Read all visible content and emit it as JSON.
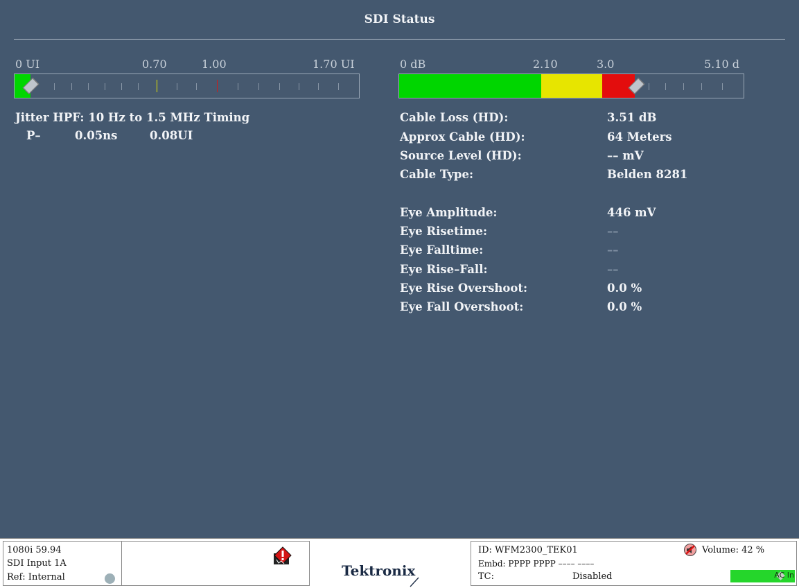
{
  "header": {
    "title": "SDI Status"
  },
  "jitter_meter": {
    "labels": {
      "min": "0 UI",
      "warn": "0.70",
      "error": "1.00",
      "max": "1.70 UI"
    },
    "value": 0.08,
    "range": [
      0,
      1.7
    ],
    "thresholds": {
      "warn": 0.7,
      "error": 1.0
    }
  },
  "cable_meter": {
    "labels": {
      "min": "0 dB",
      "warn": "2.10",
      "error": "3.0",
      "max": "5.10 d"
    },
    "value": 3.51,
    "range": [
      0,
      5.1
    ],
    "thresholds": {
      "warn": 2.1,
      "error": 3.0
    }
  },
  "jitter": {
    "title": "Jitter HPF: 10 Hz to 1.5 MHz Timing",
    "channel": "P–",
    "value_ns": "0.05ns",
    "value_ui": "0.08UI"
  },
  "cable": {
    "rows": [
      {
        "label": "Cable Loss (HD):",
        "value": "3.51 dB"
      },
      {
        "label": "Approx Cable (HD):",
        "value": "64 Meters"
      },
      {
        "label": "Source Level (HD):",
        "value": "––    mV"
      },
      {
        "label": "Cable Type:",
        "value": "Belden 8281"
      }
    ]
  },
  "eye": {
    "rows": [
      {
        "label": "Eye Amplitude:",
        "value": "446 mV"
      },
      {
        "label": "Eye Risetime:",
        "value": "––"
      },
      {
        "label": "Eye Falltime:",
        "value": "––"
      },
      {
        "label": "Eye Rise–Fall:",
        "value": "––"
      },
      {
        "label": "Eye Rise Overshoot:",
        "value": "0.0 %"
      },
      {
        "label": "Eye Fall Overshoot:",
        "value": "0.0 %"
      }
    ]
  },
  "status": {
    "format": "1080i 59.94",
    "input": "SDI Input 1A",
    "ref": "Ref: Internal",
    "brand": "Tektronix",
    "id": "ID: WFM2300_TEK01",
    "embd": "Embd: PPPP PPPP –––– ––––",
    "tc_label": "TC:",
    "tc_value": "Disabled",
    "volume": "Volume:  42 %",
    "ac": "AC In"
  },
  "colors": {
    "background": "#44586f",
    "green": "#00d600",
    "yellow": "#e7e500",
    "red": "#e30d0d"
  }
}
